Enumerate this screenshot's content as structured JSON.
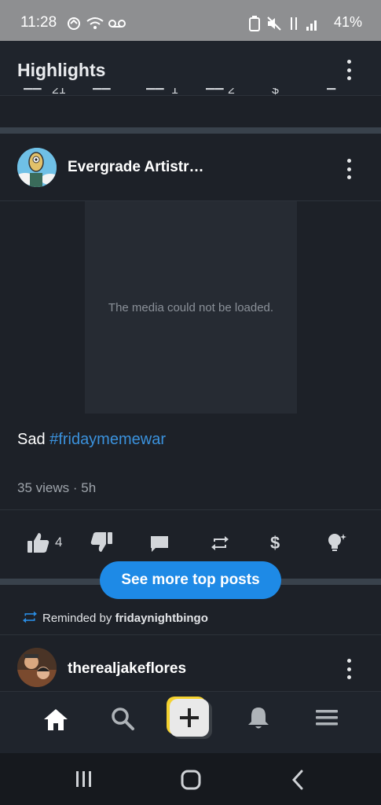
{
  "status_bar": {
    "time": "11:28",
    "battery": "41%"
  },
  "header": {
    "title": "Highlights"
  },
  "peek_row": {
    "likes": "21",
    "reposts": "2",
    "comments": "1"
  },
  "post": {
    "author": "Evergrade Artistr…",
    "media_message": "The media could not be loaded.",
    "text_prefix": "Sad ",
    "hashtag": "#fridaymemewar",
    "meta": "35 views · 5h",
    "like_count": "4",
    "icons": [
      "thumbs-up-icon",
      "thumbs-down-icon",
      "comment-icon",
      "repost-icon",
      "dollar-icon",
      "lightbulb-icon"
    ]
  },
  "see_more_button": "See more top posts",
  "reminded": {
    "prefix": "Reminded by ",
    "user": "fridaynightbingo"
  },
  "post2": {
    "author": "therealjakeflores"
  },
  "bottom_nav": {
    "items": [
      "home-icon",
      "search-icon",
      "compose-icon",
      "bell-icon",
      "menu-icon"
    ]
  },
  "colors": {
    "background": "#1d2128",
    "accent": "#1e8ae6",
    "hashtag": "#3b92dd",
    "compose_yellow": "#f4d230"
  }
}
